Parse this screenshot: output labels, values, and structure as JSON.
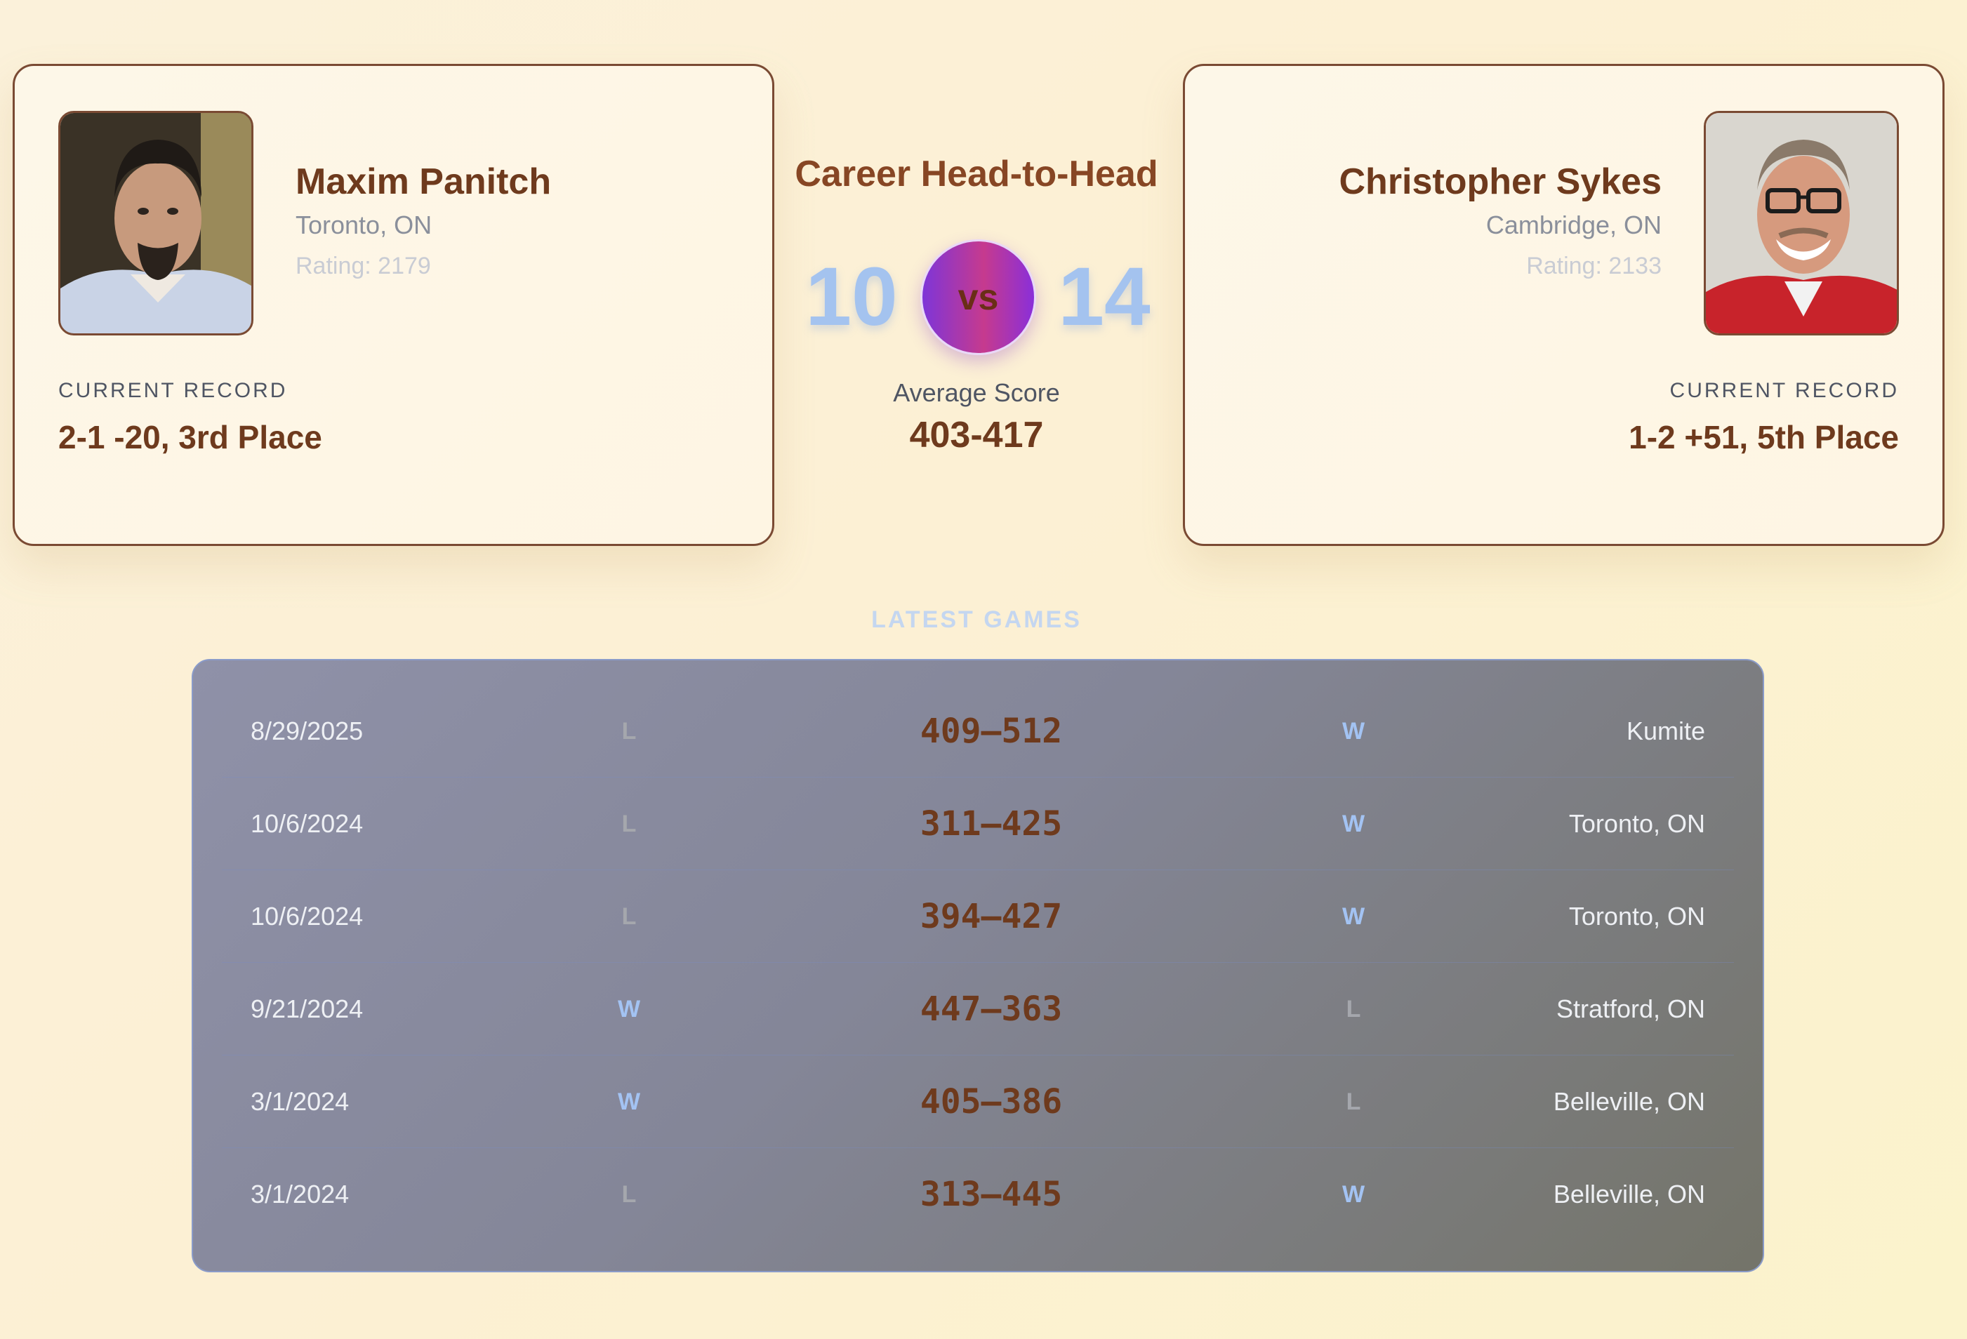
{
  "player1": {
    "name": "Maxim Panitch",
    "location": "Toronto, ON",
    "rating": "Rating: 2179",
    "record_label": "CURRENT RECORD",
    "record": "2-1 -20, 3rd Place"
  },
  "player2": {
    "name": "Christopher Sykes",
    "location": "Cambridge, ON",
    "rating": "Rating: 2133",
    "record_label": "CURRENT RECORD",
    "record": "1-2 +51, 5th Place"
  },
  "h2h": {
    "title": "Career Head-to-Head",
    "wins_player1": "10",
    "vs": "vs",
    "wins_player2": "14",
    "avg_label": "Average Score",
    "avg_value": "403-417"
  },
  "latest": {
    "label": "LATEST GAMES",
    "games": [
      {
        "date": "8/29/2025",
        "r1": "L",
        "score": "409–512",
        "r2": "W",
        "location": "Kumite"
      },
      {
        "date": "10/6/2024",
        "r1": "L",
        "score": "311–425",
        "r2": "W",
        "location": "Toronto, ON"
      },
      {
        "date": "10/6/2024",
        "r1": "L",
        "score": "394–427",
        "r2": "W",
        "location": "Toronto, ON"
      },
      {
        "date": "9/21/2024",
        "r1": "W",
        "score": "447–363",
        "r2": "L",
        "location": "Stratford, ON"
      },
      {
        "date": "3/1/2024",
        "r1": "W",
        "score": "405–386",
        "r2": "L",
        "location": "Belleville, ON"
      },
      {
        "date": "3/1/2024",
        "r1": "L",
        "score": "313–445",
        "r2": "W",
        "location": "Belleville, ON"
      }
    ]
  }
}
